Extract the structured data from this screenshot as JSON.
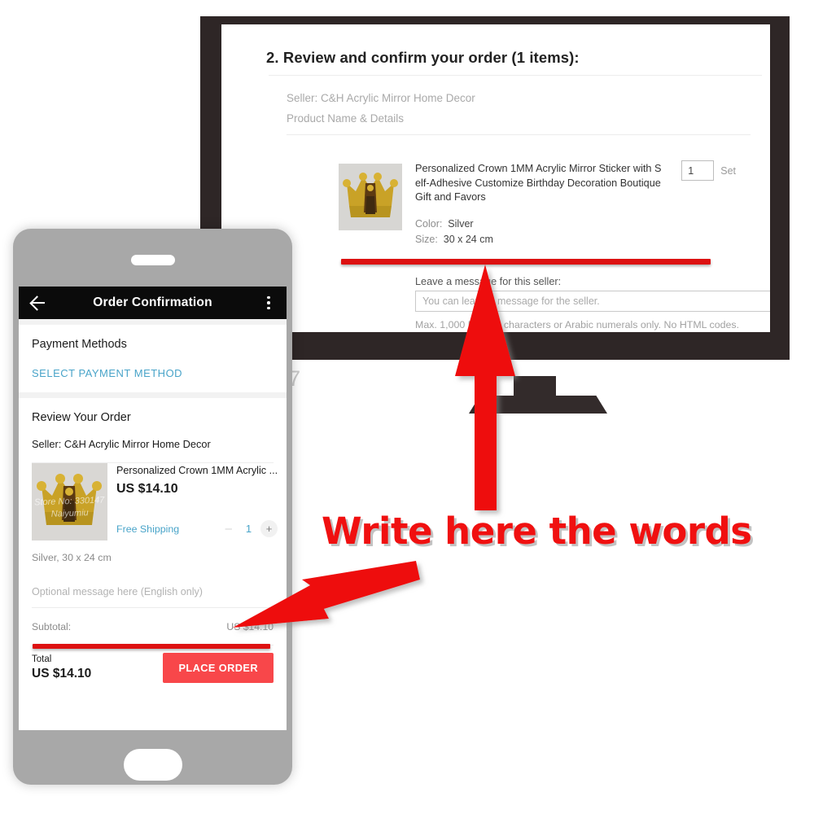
{
  "desktop": {
    "step_title": "2. Review and confirm your order (1 items):",
    "seller_line": "Seller: C&H Acrylic Mirror Home Decor",
    "product_header": "Product Name & Details",
    "product_name": "Personalized Crown 1MM Acrylic Mirror Sticker with Self-Adhesive Customize Birthday Decoration Boutique Gift and Favors",
    "color_label": "Color:",
    "color_value": "Silver",
    "size_label": "Size:",
    "size_value": "30 x 24 cm",
    "quantity_value": "1",
    "unit_label": "Set",
    "message_label": "Leave a message for this seller:",
    "message_placeholder": "You can leave a message for the seller.",
    "message_hint": "Max. 1,000 English characters or Arabic numerals only. No HTML codes.",
    "watermark": "Store No: 330147"
  },
  "phone": {
    "appbar": {
      "back_icon": "back-arrow-icon",
      "title": "Order Confirmation",
      "overflow_icon": "kebab-menu-icon"
    },
    "payment": {
      "heading": "Payment Methods",
      "select_link": "SELECT PAYMENT METHOD"
    },
    "review": {
      "heading": "Review Your Order",
      "seller_line": "Seller: C&H Acrylic Mirror Home Decor",
      "product_name": "Personalized Crown 1MM Acrylic ...",
      "price": "US $14.10",
      "shipping": "Free Shipping",
      "qty_minus": "–",
      "qty_value": "1",
      "qty_plus": "+",
      "attributes": "Silver, 30 x 24 cm",
      "message_placeholder": "Optional message here (English only)"
    },
    "summary": {
      "subtotal_label": "Subtotal:",
      "subtotal_value": "US $14.10",
      "total_label": "Total",
      "total_value": "US $14.10",
      "place_order_label": "PLACE ORDER"
    }
  },
  "annotations": {
    "callout_text": "Write here the words",
    "arrow_color": "#ee1111",
    "underline_color": "#dd1111"
  },
  "thumbnail": {
    "alt": "gold-crown-acrylic-mirror-sticker",
    "watermark_line1": "Store No: 330147",
    "watermark_line2": "Naiyumiu"
  }
}
